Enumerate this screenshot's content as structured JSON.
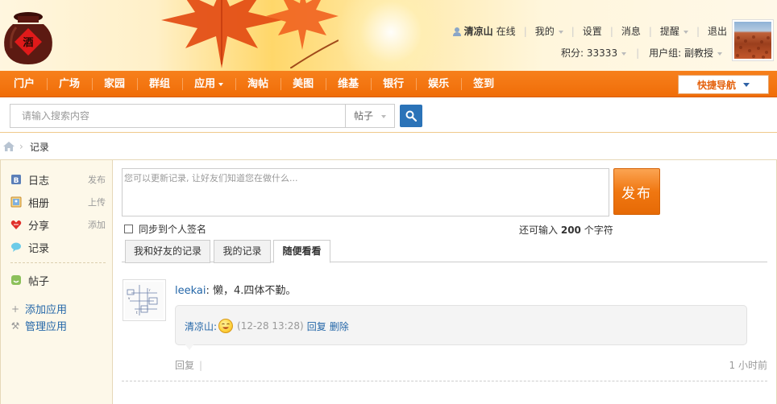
{
  "header": {
    "username": "清凉山",
    "online_status": "在线",
    "menu_my": "我的",
    "menu_settings": "设置",
    "menu_messages": "消息",
    "menu_reminders": "提醒",
    "menu_logout": "退出",
    "points_label": "积分: 33333",
    "usergroup_label": "用户组: 副教授"
  },
  "nav": {
    "items": [
      "门户",
      "广场",
      "家园",
      "群组",
      "应用",
      "淘帖",
      "美图",
      "维基",
      "银行",
      "娱乐",
      "签到"
    ],
    "quick_nav": "快捷导航"
  },
  "search": {
    "placeholder": "请输入搜索内容",
    "type": "帖子"
  },
  "breadcrumb": {
    "current": "记录"
  },
  "sidebar": {
    "items": [
      {
        "label": "日志",
        "action": "发布"
      },
      {
        "label": "相册",
        "action": "上传"
      },
      {
        "label": "分享",
        "action": "添加"
      },
      {
        "label": "记录",
        "action": ""
      },
      {
        "label": "帖子",
        "action": ""
      }
    ],
    "add_app": "添加应用",
    "manage_app": "管理应用"
  },
  "composer": {
    "placeholder": "您可以更新记录, 让好友们知道您在做什么...",
    "publish": "发布",
    "sync_label": "同步到个人签名",
    "remain_prefix": "还可输入",
    "remain_count": "200",
    "remain_suffix": "个字符"
  },
  "tabs": [
    "我和好友的记录",
    "我的记录",
    "随便看看"
  ],
  "feed": {
    "author": "leekai",
    "text": ": 懒，4.四体不勤。",
    "reply_user": "清凉山:",
    "reply_time": "(12-28 13:28)",
    "reply_action": "回复",
    "delete_action": "删除",
    "reply_link": "回复",
    "time_ago": "1 小时前"
  },
  "colors": {
    "nav_orange": "#f06d08",
    "link_blue": "#2366a8",
    "sidebar_bg": "#fdf8e9"
  }
}
